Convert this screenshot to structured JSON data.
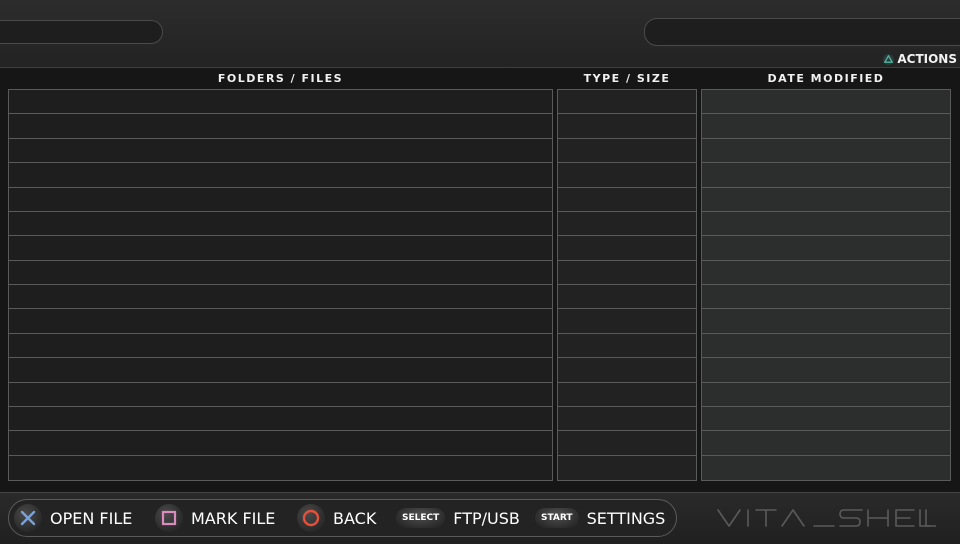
{
  "top": {
    "actions_label": "ACTIONS"
  },
  "table": {
    "columns": [
      "FOLDERS / FILES",
      "TYPE / SIZE",
      "DATE MODIFIED"
    ],
    "row_count": 16
  },
  "footer": {
    "controls": [
      {
        "button": "cross",
        "button_text": "",
        "label": "OPEN FILE"
      },
      {
        "button": "square",
        "button_text": "",
        "label": "MARK FILE"
      },
      {
        "button": "circle",
        "button_text": "",
        "label": "BACK"
      },
      {
        "button": "select",
        "button_text": "SELECT",
        "label": "FTP/USB"
      },
      {
        "button": "start",
        "button_text": "START",
        "label": "SETTINGS"
      }
    ],
    "logo_text": "VITA SHELL"
  },
  "colors": {
    "cross": "#7aa2d8",
    "square": "#d98bc0",
    "circle": "#e8503a",
    "triangle": "#4fb5a0",
    "date_column_bg": "#2c2e2e",
    "name_column_bg": "#1e1e1e"
  }
}
